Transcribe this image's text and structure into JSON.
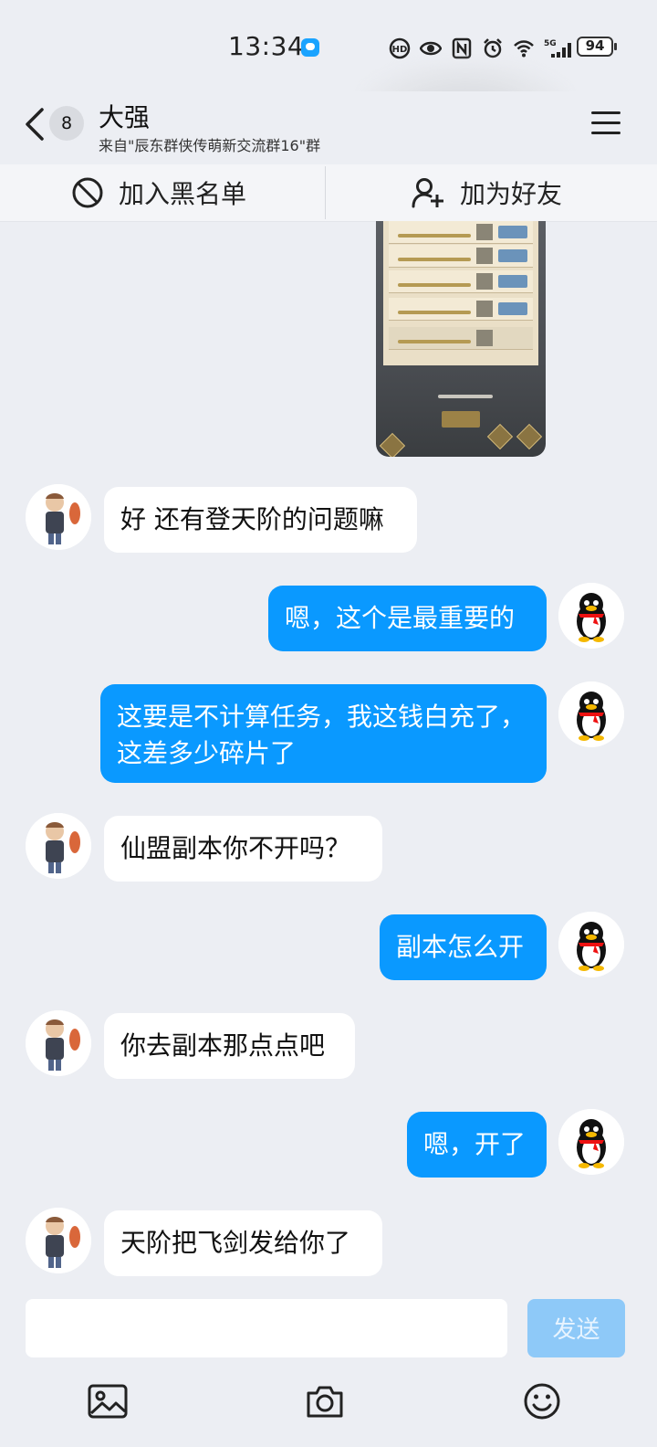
{
  "status_bar": {
    "time": "13:34",
    "battery": "94",
    "network": "5G",
    "icons": [
      "hd-icon",
      "eye-icon",
      "nfc-icon",
      "alarm-icon",
      "wifi-icon",
      "signal-icon"
    ]
  },
  "header": {
    "unread_count": "8",
    "contact_name": "大强",
    "source": "来自\"辰东群侠传萌新交流群16\"群"
  },
  "actions": {
    "blacklist": "加入黑名单",
    "add_friend": "加为好友"
  },
  "messages": [
    {
      "side": "in",
      "text": "好 还有登天阶的问题嘛"
    },
    {
      "side": "out",
      "text": "嗯，这个是最重要的"
    },
    {
      "side": "out",
      "text": "这要是不计算任务，我这钱白充了，这差多少碎片了"
    },
    {
      "side": "in",
      "text": "仙盟副本你不开吗？"
    },
    {
      "side": "out",
      "text": "副本怎么开"
    },
    {
      "side": "in",
      "text": "你去副本那点点吧"
    },
    {
      "side": "out",
      "text": "嗯，开了"
    },
    {
      "side": "in",
      "text": "天阶把飞剑发给你了"
    }
  ],
  "input": {
    "value": "",
    "send_label": "发送"
  },
  "colors": {
    "outgoing_bubble": "#0a99ff",
    "incoming_bubble": "#ffffff",
    "background": "#eceef3",
    "send_button_disabled": "#8ec9f8"
  }
}
